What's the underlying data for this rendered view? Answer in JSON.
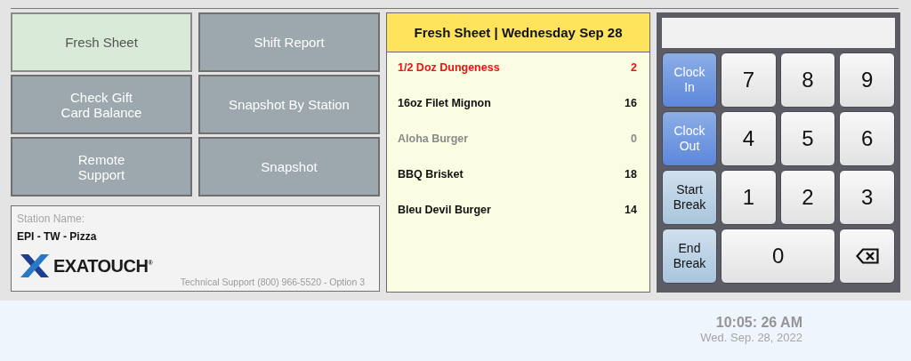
{
  "menu_buttons": [
    {
      "label": "Fresh Sheet",
      "selected": true
    },
    {
      "label": "Shift Report",
      "selected": false
    },
    {
      "label": "Check Gift\nCard Balance",
      "selected": false
    },
    {
      "label": "Snapshot By Station",
      "selected": false
    },
    {
      "label": "Remote\nSupport",
      "selected": false
    },
    {
      "label": "Snapshot",
      "selected": false
    }
  ],
  "station": {
    "label": "Station Name:",
    "name": "EPI - TW - Pizza",
    "logo_text": "EXATOUCH$^{®}$",
    "support": "Technical Support (800) 966-5520 - Option 3"
  },
  "fresh_sheet": {
    "title": "Fresh Sheet | Wednesday Sep 28",
    "items": [
      {
        "name": "1/2 Doz Dungeness",
        "count": "2",
        "color": "#ee1111"
      },
      {
        "name": "16oz Filet Mignon",
        "count": "16",
        "color": "#111111"
      },
      {
        "name": "Aloha Burger",
        "count": "0",
        "color": "#8a8a8a"
      },
      {
        "name": "BBQ Brisket",
        "count": "18",
        "color": "#111111"
      },
      {
        "name": "Bleu Devil Burger",
        "count": "14",
        "color": "#111111"
      }
    ]
  },
  "time_buttons": [
    {
      "label": "Clock\nIn",
      "kind": "clock"
    },
    {
      "label": "Clock\nOut",
      "kind": "clock"
    },
    {
      "label": "Start\nBreak",
      "kind": "break"
    },
    {
      "label": "End\nBreak",
      "kind": "break"
    }
  ],
  "keys": [
    {
      "label": "7",
      "kind": "digit"
    },
    {
      "label": "8",
      "kind": "digit"
    },
    {
      "label": "9",
      "kind": "digit"
    },
    {
      "label": "4",
      "kind": "digit"
    },
    {
      "label": "5",
      "kind": "digit"
    },
    {
      "label": "6",
      "kind": "digit"
    },
    {
      "label": "1",
      "kind": "digit"
    },
    {
      "label": "2",
      "kind": "digit"
    },
    {
      "label": "3",
      "kind": "digit"
    },
    {
      "label": "0",
      "kind": "wide"
    },
    {
      "kind": "backspace"
    }
  ],
  "clock": {
    "time": "10:05: 26 AM",
    "date": "Wed. Sep. 28, 2022"
  }
}
